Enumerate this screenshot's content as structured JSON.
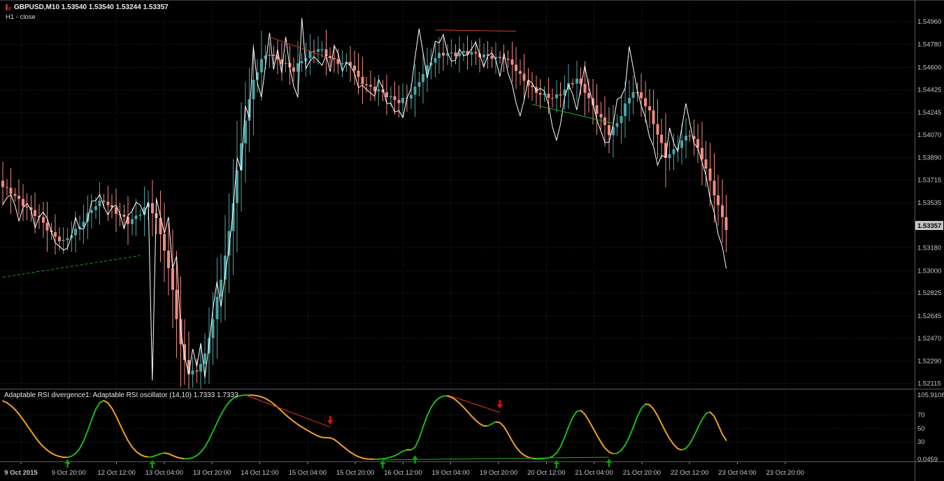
{
  "ui": {
    "symbol_line": "GBPUSD,M10 1.53540 1.53540 1.53244 1.53357",
    "quote": {
      "symbol": "GBPUSD",
      "timeframe": "M10",
      "open": "1.53540",
      "high": "1.53540",
      "low": "1.53244",
      "close": "1.53357"
    },
    "overlay_label": "H1 - close",
    "indicator_label": "Adaptable RSI divergence1: Adaptable RSI oscillator (14,10) 1.7333 1.7333"
  },
  "chart_data": [
    {
      "type": "candlestick",
      "symbol": "GBPUSD",
      "timeframe": "M10",
      "overlay_line_name": "H1 - close",
      "bars": 180,
      "up_color": "#4aa3a3",
      "down_color": "#f08a82",
      "line_color": "#ffffff",
      "current_price": "1.53357",
      "y_tick_labels": [
        "1.54960",
        "1.54780",
        "1.54600",
        "1.54425",
        "1.54245",
        "1.54070",
        "1.53890",
        "1.53715",
        "1.53535",
        "1.53180",
        "1.53000",
        "1.52825",
        "1.52645",
        "1.52470",
        "1.52290",
        "1.52115"
      ],
      "x_tick_labels": [
        "9 Oct 2015",
        "9 Oct 20:00",
        "12 Oct 12:00",
        "13 Oct 04:00",
        "13 Oct 20:00",
        "14 Oct 12:00",
        "15 Oct 04:00",
        "15 Oct 20:00",
        "16 Oct 12:00",
        "19 Oct 04:00",
        "19 Oct 20:00",
        "20 Oct 12:00",
        "21 Oct 04:00",
        "21 Oct 20:00",
        "22 Oct 12:00",
        "23 Oct 04:00",
        "23 Oct 20:00"
      ],
      "close_anchors": [
        [
          0,
          1.5366
        ],
        [
          4,
          1.5356
        ],
        [
          8,
          1.5344
        ],
        [
          12,
          1.533
        ],
        [
          15,
          1.5322
        ],
        [
          18,
          1.5332
        ],
        [
          22,
          1.5348
        ],
        [
          25,
          1.5356
        ],
        [
          28,
          1.5346
        ],
        [
          31,
          1.5338
        ],
        [
          34,
          1.5346
        ],
        [
          36,
          1.5352
        ],
        [
          38,
          1.534
        ],
        [
          40,
          1.5318
        ],
        [
          42,
          1.5285
        ],
        [
          44,
          1.524
        ],
        [
          46,
          1.522
        ],
        [
          48,
          1.5222
        ],
        [
          50,
          1.5233
        ],
        [
          52,
          1.5262
        ],
        [
          54,
          1.5295
        ],
        [
          56,
          1.533
        ],
        [
          58,
          1.5378
        ],
        [
          60,
          1.542
        ],
        [
          62,
          1.545
        ],
        [
          64,
          1.5465
        ],
        [
          66,
          1.5471
        ],
        [
          68,
          1.5467
        ],
        [
          70,
          1.5462
        ],
        [
          72,
          1.5457
        ],
        [
          74,
          1.5466
        ],
        [
          76,
          1.5472
        ],
        [
          78,
          1.5474
        ],
        [
          80,
          1.547
        ],
        [
          82,
          1.5466
        ],
        [
          84,
          1.5463
        ],
        [
          86,
          1.5462
        ],
        [
          88,
          1.5452
        ],
        [
          90,
          1.5446
        ],
        [
          92,
          1.5442
        ],
        [
          94,
          1.544
        ],
        [
          96,
          1.5437
        ],
        [
          98,
          1.5433
        ],
        [
          100,
          1.5435
        ],
        [
          102,
          1.5444
        ],
        [
          104,
          1.5456
        ],
        [
          106,
          1.5464
        ],
        [
          108,
          1.547
        ],
        [
          110,
          1.5472
        ],
        [
          112,
          1.547
        ],
        [
          114,
          1.5471
        ],
        [
          116,
          1.5472
        ],
        [
          118,
          1.547
        ],
        [
          120,
          1.5468
        ],
        [
          122,
          1.5467
        ],
        [
          124,
          1.5469
        ],
        [
          126,
          1.5462
        ],
        [
          128,
          1.5453
        ],
        [
          130,
          1.5447
        ],
        [
          132,
          1.5441
        ],
        [
          134,
          1.5437
        ],
        [
          136,
          1.5436
        ],
        [
          138,
          1.544
        ],
        [
          140,
          1.5446
        ],
        [
          142,
          1.545
        ],
        [
          144,
          1.5442
        ],
        [
          146,
          1.543
        ],
        [
          148,
          1.5419
        ],
        [
          150,
          1.5408
        ],
        [
          152,
          1.5417
        ],
        [
          154,
          1.543
        ],
        [
          156,
          1.5441
        ],
        [
          158,
          1.5437
        ],
        [
          160,
          1.5425
        ],
        [
          162,
          1.5407
        ],
        [
          164,
          1.539
        ],
        [
          166,
          1.5395
        ],
        [
          168,
          1.5402
        ],
        [
          170,
          1.5407
        ],
        [
          171,
          1.5403
        ],
        [
          173,
          1.539
        ],
        [
          175,
          1.537
        ],
        [
          177,
          1.535
        ],
        [
          179,
          1.5334
        ]
      ],
      "line_anchors": [
        [
          0,
          1.5352
        ],
        [
          2,
          1.536
        ],
        [
          4,
          1.5342
        ],
        [
          6,
          1.5354
        ],
        [
          8,
          1.5336
        ],
        [
          10,
          1.5348
        ],
        [
          13,
          1.5322
        ],
        [
          16,
          1.5316
        ],
        [
          18,
          1.534
        ],
        [
          20,
          1.5332
        ],
        [
          22,
          1.5352
        ],
        [
          24,
          1.536
        ],
        [
          26,
          1.5344
        ],
        [
          28,
          1.5352
        ],
        [
          30,
          1.5336
        ],
        [
          32,
          1.5348
        ],
        [
          34,
          1.5354
        ],
        [
          35,
          1.5344
        ],
        [
          36,
          1.5356
        ],
        [
          37,
          1.5212
        ],
        [
          38,
          1.5356
        ],
        [
          40,
          1.533
        ],
        [
          41,
          1.5344
        ],
        [
          42,
          1.53
        ],
        [
          43,
          1.5312
        ],
        [
          44,
          1.5252
        ],
        [
          46,
          1.5218
        ],
        [
          47,
          1.524
        ],
        [
          48,
          1.5222
        ],
        [
          49,
          1.5244
        ],
        [
          50,
          1.5216
        ],
        [
          52,
          1.527
        ],
        [
          53,
          1.529
        ],
        [
          54,
          1.5272
        ],
        [
          55,
          1.5296
        ],
        [
          57,
          1.5346
        ],
        [
          58,
          1.539
        ],
        [
          59,
          1.5376
        ],
        [
          60,
          1.5432
        ],
        [
          61,
          1.542
        ],
        [
          62,
          1.5478
        ],
        [
          63,
          1.5446
        ],
        [
          64,
          1.5436
        ],
        [
          66,
          1.5488
        ],
        [
          67,
          1.546
        ],
        [
          68,
          1.5472
        ],
        [
          69,
          1.5456
        ],
        [
          70,
          1.5482
        ],
        [
          72,
          1.5444
        ],
        [
          73,
          1.5438
        ],
        [
          74,
          1.5496
        ],
        [
          75,
          1.546
        ],
        [
          77,
          1.547
        ],
        [
          79,
          1.546
        ],
        [
          80,
          1.547
        ],
        [
          81,
          1.5456
        ],
        [
          82,
          1.548
        ],
        [
          84,
          1.5458
        ],
        [
          86,
          1.5464
        ],
        [
          88,
          1.5446
        ],
        [
          90,
          1.5442
        ],
        [
          92,
          1.5438
        ],
        [
          93,
          1.5452
        ],
        [
          95,
          1.5432
        ],
        [
          97,
          1.5428
        ],
        [
          99,
          1.5422
        ],
        [
          101,
          1.5444
        ],
        [
          103,
          1.5492
        ],
        [
          105,
          1.545
        ],
        [
          107,
          1.548
        ],
        [
          109,
          1.5484
        ],
        [
          111,
          1.5462
        ],
        [
          113,
          1.5474
        ],
        [
          115,
          1.5468
        ],
        [
          117,
          1.548
        ],
        [
          119,
          1.5462
        ],
        [
          121,
          1.5472
        ],
        [
          123,
          1.5456
        ],
        [
          124,
          1.547
        ],
        [
          126,
          1.5444
        ],
        [
          128,
          1.5422
        ],
        [
          130,
          1.545
        ],
        [
          132,
          1.5442
        ],
        [
          134,
          1.5444
        ],
        [
          136,
          1.5414
        ],
        [
          137,
          1.54
        ],
        [
          139,
          1.5436
        ],
        [
          140,
          1.5448
        ],
        [
          142,
          1.5426
        ],
        [
          144,
          1.5462
        ],
        [
          146,
          1.543
        ],
        [
          148,
          1.5408
        ],
        [
          150,
          1.54
        ],
        [
          152,
          1.5432
        ],
        [
          154,
          1.5444
        ],
        [
          155,
          1.5478
        ],
        [
          157,
          1.544
        ],
        [
          159,
          1.542
        ],
        [
          161,
          1.5396
        ],
        [
          162,
          1.5384
        ],
        [
          164,
          1.5392
        ],
        [
          165,
          1.5412
        ],
        [
          167,
          1.5392
        ],
        [
          169,
          1.5432
        ],
        [
          171,
          1.5402
        ],
        [
          173,
          1.5386
        ],
        [
          175,
          1.536
        ],
        [
          177,
          1.533
        ],
        [
          179,
          1.5303
        ]
      ],
      "trend_lines": [
        {
          "points": [
            [
              0,
              1.5295
            ],
            [
              34,
              1.5312
            ]
          ],
          "color": "#1e9e1e",
          "dash": "4 3"
        },
        {
          "points": [
            [
              131,
              1.5431
            ],
            [
              151,
              1.5416
            ]
          ],
          "color": "#27ae27",
          "dash": ""
        },
        {
          "points": [
            [
              66,
              1.5484
            ],
            [
              82,
              1.5466
            ]
          ],
          "color": "#d23b2f",
          "dash": ""
        },
        {
          "points": [
            [
              107,
              1.54895
            ],
            [
              127,
              1.54885
            ]
          ],
          "color": "#d23b2f",
          "dash": ""
        }
      ]
    },
    {
      "type": "line",
      "name": "Adaptable RSI divergence1",
      "subtitle": "Adaptable RSI oscillator (14,10)",
      "values_display": [
        "1.7333",
        "1.7333"
      ],
      "rise_color": "#1db51d",
      "fall_color": "#efa020",
      "levels": [
        70,
        50,
        30
      ],
      "scale_labels": [
        {
          "text": "105.9108",
          "v": 100.2
        },
        {
          "text": "70",
          "v": 70
        },
        {
          "text": "50",
          "v": 50
        },
        {
          "text": "30",
          "v": 30
        },
        {
          "text": "0.0459",
          "v": 3.8
        }
      ],
      "anchors": [
        [
          0,
          93
        ],
        [
          3,
          80
        ],
        [
          6,
          55
        ],
        [
          9,
          28
        ],
        [
          12,
          12
        ],
        [
          15,
          6
        ],
        [
          17,
          7
        ],
        [
          19,
          16
        ],
        [
          21,
          45
        ],
        [
          23,
          82
        ],
        [
          24,
          94
        ],
        [
          26,
          92
        ],
        [
          28,
          70
        ],
        [
          30,
          42
        ],
        [
          32,
          20
        ],
        [
          34,
          10
        ],
        [
          36,
          6
        ],
        [
          38,
          9
        ],
        [
          40,
          16
        ],
        [
          42,
          9
        ],
        [
          44,
          5
        ],
        [
          46,
          4
        ],
        [
          48,
          8
        ],
        [
          50,
          20
        ],
        [
          52,
          45
        ],
        [
          54,
          72
        ],
        [
          56,
          92
        ],
        [
          58,
          99
        ],
        [
          60,
          100
        ],
        [
          62,
          100
        ],
        [
          64,
          98
        ],
        [
          66,
          92
        ],
        [
          68,
          82
        ],
        [
          70,
          70
        ],
        [
          72,
          60
        ],
        [
          74,
          52
        ],
        [
          76,
          45
        ],
        [
          78,
          38
        ],
        [
          80,
          34
        ],
        [
          81,
          40
        ],
        [
          82,
          34
        ],
        [
          84,
          24
        ],
        [
          86,
          14
        ],
        [
          88,
          7
        ],
        [
          90,
          4
        ],
        [
          92,
          4
        ],
        [
          94,
          4
        ],
        [
          96,
          7
        ],
        [
          98,
          11
        ],
        [
          100,
          22
        ],
        [
          102,
          12
        ],
        [
          104,
          55
        ],
        [
          106,
          85
        ],
        [
          108,
          98
        ],
        [
          110,
          100
        ],
        [
          112,
          94
        ],
        [
          114,
          82
        ],
        [
          116,
          68
        ],
        [
          118,
          56
        ],
        [
          120,
          50
        ],
        [
          122,
          64
        ],
        [
          124,
          56
        ],
        [
          126,
          30
        ],
        [
          128,
          13
        ],
        [
          130,
          6
        ],
        [
          132,
          4
        ],
        [
          134,
          5
        ],
        [
          136,
          6
        ],
        [
          138,
          18
        ],
        [
          140,
          55
        ],
        [
          142,
          80
        ],
        [
          143,
          82
        ],
        [
          145,
          62
        ],
        [
          147,
          40
        ],
        [
          149,
          18
        ],
        [
          151,
          10
        ],
        [
          153,
          14
        ],
        [
          155,
          35
        ],
        [
          157,
          68
        ],
        [
          158,
          86
        ],
        [
          160,
          90
        ],
        [
          162,
          70
        ],
        [
          164,
          44
        ],
        [
          166,
          24
        ],
        [
          168,
          14
        ],
        [
          170,
          24
        ],
        [
          172,
          52
        ],
        [
          174,
          76
        ],
        [
          175,
          80
        ],
        [
          176,
          72
        ],
        [
          178,
          40
        ],
        [
          179,
          26
        ]
      ],
      "divergence_lines": [
        {
          "points": [
            [
              60,
              100
            ],
            [
              81,
              52
            ]
          ],
          "color": "#d23b2f",
          "dash": ""
        },
        {
          "points": [
            [
              110,
              100
            ],
            [
              123,
              74
            ]
          ],
          "color": "#d23b2f",
          "dash": ""
        },
        {
          "points": [
            [
              94,
              3
            ],
            [
              150,
              7
            ]
          ],
          "color": "#1fae1f",
          "dash": ""
        }
      ],
      "arrows": [
        {
          "bar": 81,
          "value": 56,
          "dir": "down",
          "color": "#e01010"
        },
        {
          "bar": 123,
          "value": 80,
          "dir": "down",
          "color": "#e01010"
        },
        {
          "bar": 16,
          "value": 4,
          "dir": "up",
          "color": "#00a000"
        },
        {
          "bar": 37,
          "value": 3,
          "dir": "up",
          "color": "#00a000"
        },
        {
          "bar": 94,
          "value": 3,
          "dir": "up",
          "color": "#00a000"
        },
        {
          "bar": 102,
          "value": 10,
          "dir": "up",
          "color": "#00a000"
        },
        {
          "bar": 137,
          "value": 3,
          "dir": "up",
          "color": "#00a000"
        },
        {
          "bar": 150,
          "value": 5,
          "dir": "up",
          "color": "#00a000"
        }
      ]
    }
  ]
}
